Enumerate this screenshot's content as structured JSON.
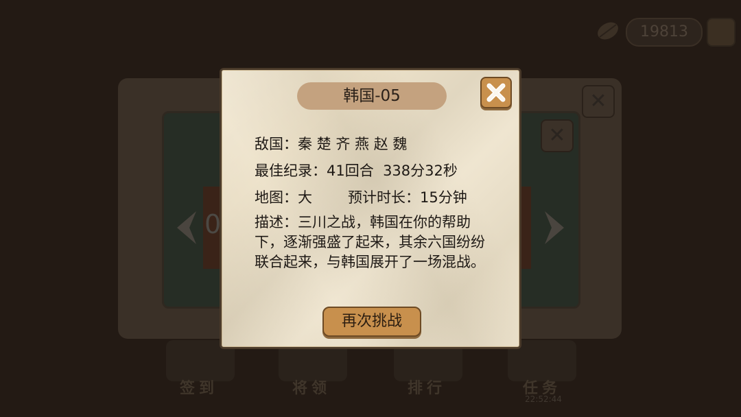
{
  "background": {
    "coins": "19813",
    "level_number_partial": "0",
    "menu": [
      {
        "label": "签到"
      },
      {
        "label": "将领"
      },
      {
        "label": "排行"
      },
      {
        "label": "任务"
      }
    ],
    "task_timer": "22:52:44"
  },
  "modal": {
    "title": "韩国-05",
    "enemy_label": "敌国：",
    "enemies": "秦 楚 齐 燕 赵 魏",
    "best_record_label": "最佳纪录：",
    "best_record": "41回合  338分32秒",
    "map_label": "地图：",
    "map_size": "大",
    "duration_label": "预计时长：",
    "duration": "15分钟",
    "description_label": "描述：",
    "description": "三川之战，韩国在你的帮助下，逐渐强盛了起来，其余六国纷纷联合起来，与韩国展开了一场混战。",
    "retry_button": "再次挑战"
  },
  "colors": {
    "paper": "#ece0c6",
    "title_pill": "#c4a27f",
    "button": "#c8904d",
    "dim_background": "#231a14"
  },
  "icons": {
    "close": "close-icon",
    "coin": "leaf-coin-icon",
    "add": "add-coins-icon",
    "nav_left": "left-arrow-icon",
    "nav_right": "right-arrow-icon"
  }
}
